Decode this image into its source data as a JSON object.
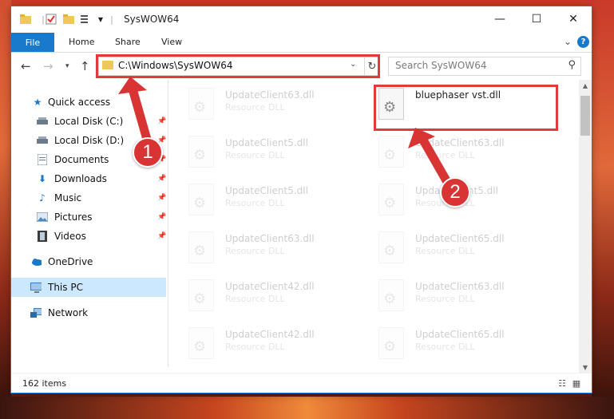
{
  "window": {
    "title": "SysWOW64",
    "controls": {
      "minimize": "—",
      "maximize": "☐",
      "close": "✕"
    }
  },
  "ribbon": {
    "tabs": [
      "File",
      "Home",
      "Share",
      "View"
    ],
    "expand_icon": "chevron-down-icon",
    "help_label": "?"
  },
  "address_bar": {
    "path": "C:\\Windows\\SysWOW64",
    "search_placeholder": "Search SysWOW64"
  },
  "nav_pane": {
    "items": [
      {
        "label": "Quick access",
        "icon": "star-icon",
        "pinned": false
      },
      {
        "label": "Local Disk (C:)",
        "icon": "drive-icon",
        "pinned": true
      },
      {
        "label": "Local Disk (D:)",
        "icon": "drive-icon",
        "pinned": true
      },
      {
        "label": "Documents",
        "icon": "documents-icon",
        "pinned": true
      },
      {
        "label": "Downloads",
        "icon": "download-icon",
        "pinned": true
      },
      {
        "label": "Music",
        "icon": "music-icon",
        "pinned": true
      },
      {
        "label": "Pictures",
        "icon": "pictures-icon",
        "pinned": true
      },
      {
        "label": "Videos",
        "icon": "videos-icon",
        "pinned": true
      },
      {
        "label": "OneDrive",
        "icon": "cloud-icon",
        "pinned": false
      },
      {
        "label": "This PC",
        "icon": "computer-icon",
        "pinned": false,
        "selected": true
      },
      {
        "label": "Network",
        "icon": "network-icon",
        "pinned": false
      }
    ]
  },
  "files": {
    "highlighted": {
      "name": "bluephaser vst.dll",
      "type": ""
    },
    "left_column": [
      {
        "name": "UpdateClient63.dll",
        "type": "Resource DLL"
      },
      {
        "name": "UpdateClient5.dll",
        "type": "Resource DLL"
      },
      {
        "name": "UpdateClient5.dll",
        "type": "Resource DLL"
      },
      {
        "name": "UpdateClient63.dll",
        "type": "Resource DLL"
      },
      {
        "name": "UpdateClient42.dll",
        "type": "Resource DLL"
      },
      {
        "name": "UpdateClient42.dll",
        "type": "Resource DLL"
      }
    ],
    "right_column": [
      {
        "name": "UpdateClient63.dll",
        "type": "Resource DLL"
      },
      {
        "name": "UpdateClient5.dll",
        "type": "Resource DLL"
      },
      {
        "name": "UpdateClient65.dll",
        "type": "Resource DLL"
      },
      {
        "name": "UpdateClient63.dll",
        "type": "Resource DLL"
      },
      {
        "name": "UpdateClient65.dll",
        "type": "Resource DLL"
      }
    ]
  },
  "status": {
    "item_count": "162 items"
  },
  "annotations": {
    "step1": "1",
    "step2": "2",
    "highlight_color": "#e03a3a",
    "marker_color": "#d93434"
  },
  "colors": {
    "accent": "#1979ca",
    "selected_bg": "#cce8ff"
  }
}
